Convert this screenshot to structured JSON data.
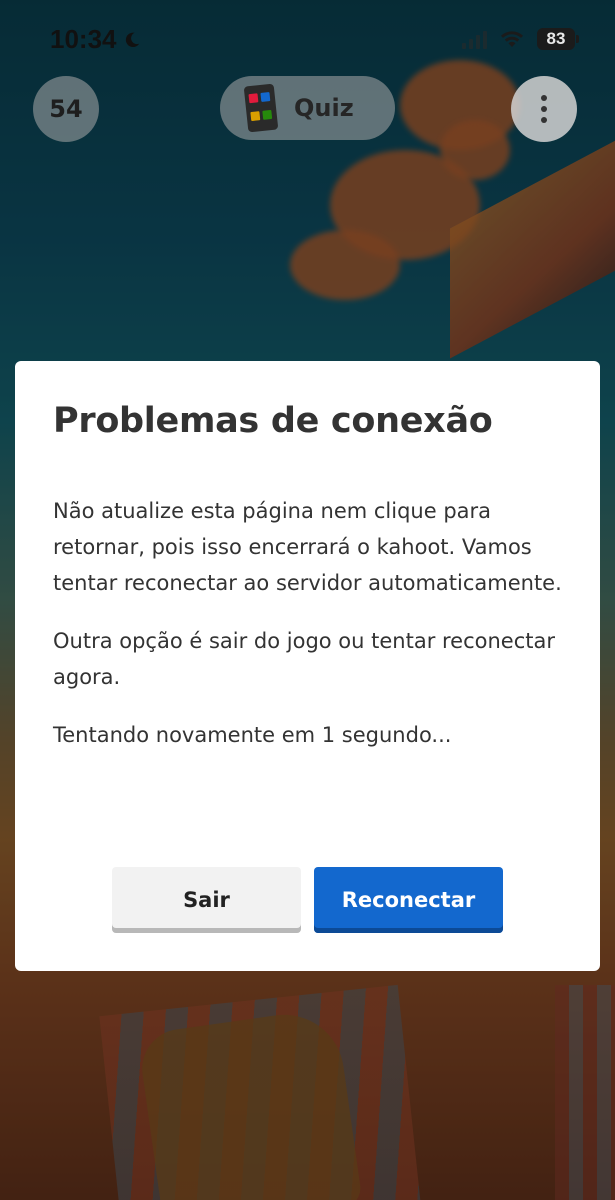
{
  "status_bar": {
    "time": "10:34",
    "battery": "83"
  },
  "header": {
    "score": "54",
    "mode_label": "Quiz"
  },
  "dialog": {
    "title": "Problemas de conexão",
    "paragraphs": [
      "Não atualize esta página nem clique para retornar, pois isso encerrará o kahoot. Vamos tentar reconectar ao servidor automaticamente.",
      "Outra opção é sair do jogo ou tentar reconectar agora.",
      "Tentando novamente em 1 segundo..."
    ],
    "buttons": {
      "exit_label": "Sair",
      "reconnect_label": "Reconectar"
    }
  },
  "colors": {
    "primary_button": "#1368ce",
    "secondary_button": "#f2f2f2",
    "dialog_background": "#ffffff",
    "text": "#333333"
  },
  "icons": {
    "status": [
      "moon-icon",
      "signal-icon",
      "wifi-icon",
      "battery-icon"
    ],
    "header": [
      "quiz-icon",
      "more-options-icon"
    ]
  }
}
